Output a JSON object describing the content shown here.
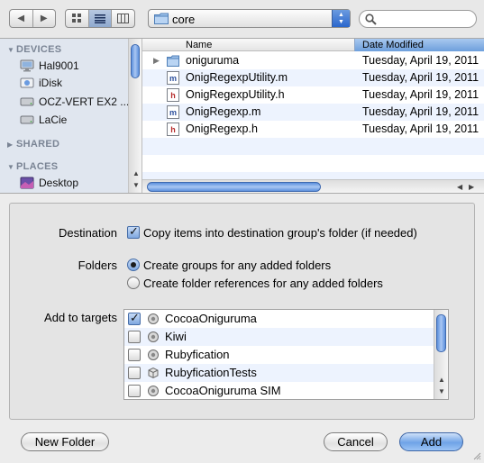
{
  "toolbar": {
    "back_icon": "back-arrow-icon",
    "forward_icon": "forward-arrow-icon",
    "view_modes": [
      "icon-view-icon",
      "list-view-icon",
      "column-view-icon"
    ],
    "active_view": "list",
    "path": "core",
    "search_placeholder": ""
  },
  "sidebar": {
    "sections": [
      {
        "title": "DEVICES",
        "expanded": true
      },
      {
        "title": "SHARED",
        "expanded": false
      },
      {
        "title": "PLACES",
        "expanded": true
      }
    ],
    "devices": [
      {
        "label": "Hal9001",
        "icon": "computer-icon"
      },
      {
        "label": "iDisk",
        "icon": "idisk-icon"
      },
      {
        "label": "OCZ-VERT EX2 ...",
        "icon": "harddisk-icon"
      },
      {
        "label": "LaCie",
        "icon": "harddisk-icon"
      }
    ],
    "places": [
      {
        "label": "Desktop",
        "icon": "desktop-icon"
      }
    ]
  },
  "file_list": {
    "columns": {
      "name": "Name",
      "date": "Date Modified"
    },
    "files": [
      {
        "name": "oniguruma",
        "date": "Tuesday, April 19, 2011",
        "type": "folder"
      },
      {
        "name": "OnigRegexpUtility.m",
        "date": "Tuesday, April 19, 2011",
        "type": "m"
      },
      {
        "name": "OnigRegexpUtility.h",
        "date": "Tuesday, April 19, 2011",
        "type": "h"
      },
      {
        "name": "OnigRegexp.m",
        "date": "Tuesday, April 19, 2011",
        "type": "m"
      },
      {
        "name": "OnigRegexp.h",
        "date": "Tuesday, April 19, 2011",
        "type": "h"
      }
    ]
  },
  "options": {
    "destination_label": "Destination",
    "copy_items": {
      "label": "Copy items into destination group's folder (if needed)",
      "checked": true
    },
    "folders_label": "Folders",
    "folder_options": [
      {
        "label": "Create groups for any added folders",
        "selected": true
      },
      {
        "label": "Create folder references for any added folders",
        "selected": false
      }
    ],
    "targets_label": "Add to targets",
    "targets": [
      {
        "name": "CocoaOniguruma",
        "checked": true,
        "icon": "target-app-icon"
      },
      {
        "name": "Kiwi",
        "checked": false,
        "icon": "target-app-icon"
      },
      {
        "name": "Rubyfication",
        "checked": false,
        "icon": "target-app-icon"
      },
      {
        "name": "RubyficationTests",
        "checked": false,
        "icon": "target-bundle-icon"
      },
      {
        "name": "CocoaOniguruma SIM",
        "checked": false,
        "icon": "target-app-icon"
      }
    ]
  },
  "buttons": {
    "new_folder": "New Folder",
    "cancel": "Cancel",
    "add": "Add"
  }
}
